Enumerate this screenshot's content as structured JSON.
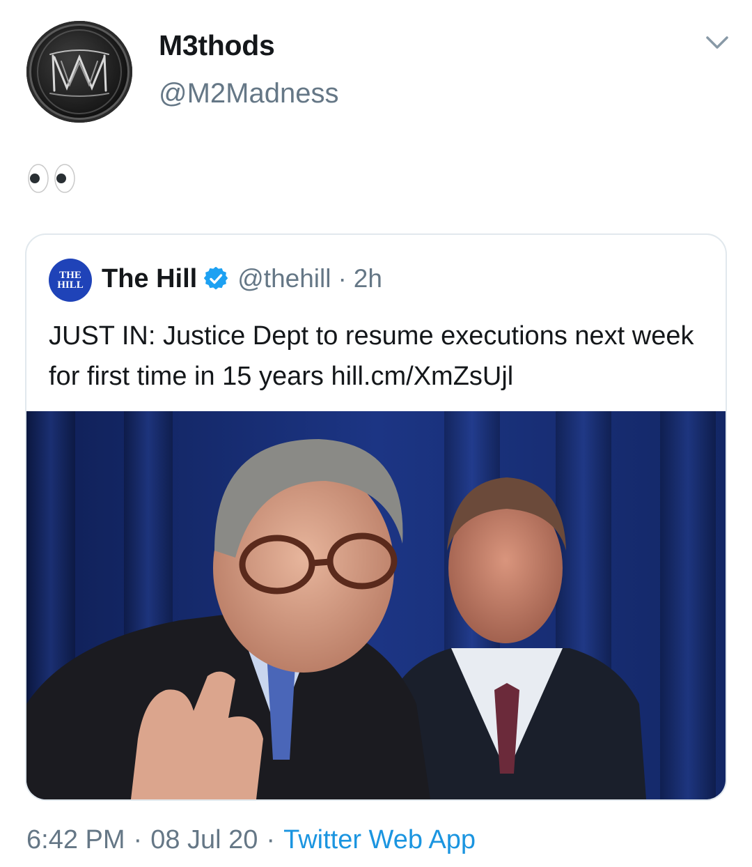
{
  "tweet": {
    "author": {
      "display_name": "M3thods",
      "handle": "@M2Madness",
      "avatar_icon": "m-monogram-logo",
      "avatar_text": "MM"
    },
    "menu_icon": "chevron-down-icon",
    "body_emoji": "eyes-emoji",
    "quoted": {
      "avatar_text_line1": "THE",
      "avatar_text_line2": "HILL",
      "name": "The Hill",
      "verified_icon": "verified-badge-icon",
      "handle": "@thehill",
      "separator": "·",
      "time": "2h",
      "text": "JUST IN: Justice Dept to resume executions next week for first time in 15 years hill.cm/XmZsUjl",
      "media": "photo-man-with-glasses-at-podium"
    },
    "footer": {
      "time": "6:42 PM",
      "separator": "·",
      "date": "08 Jul 20",
      "separator2": "·",
      "source": "Twitter Web App"
    }
  },
  "colors": {
    "text_primary": "#14171a",
    "text_secondary": "#657786",
    "link": "#1b95e0",
    "verified": "#1da1f2",
    "border": "#e1e8ed",
    "the_hill_brand": "#1f43b8"
  }
}
